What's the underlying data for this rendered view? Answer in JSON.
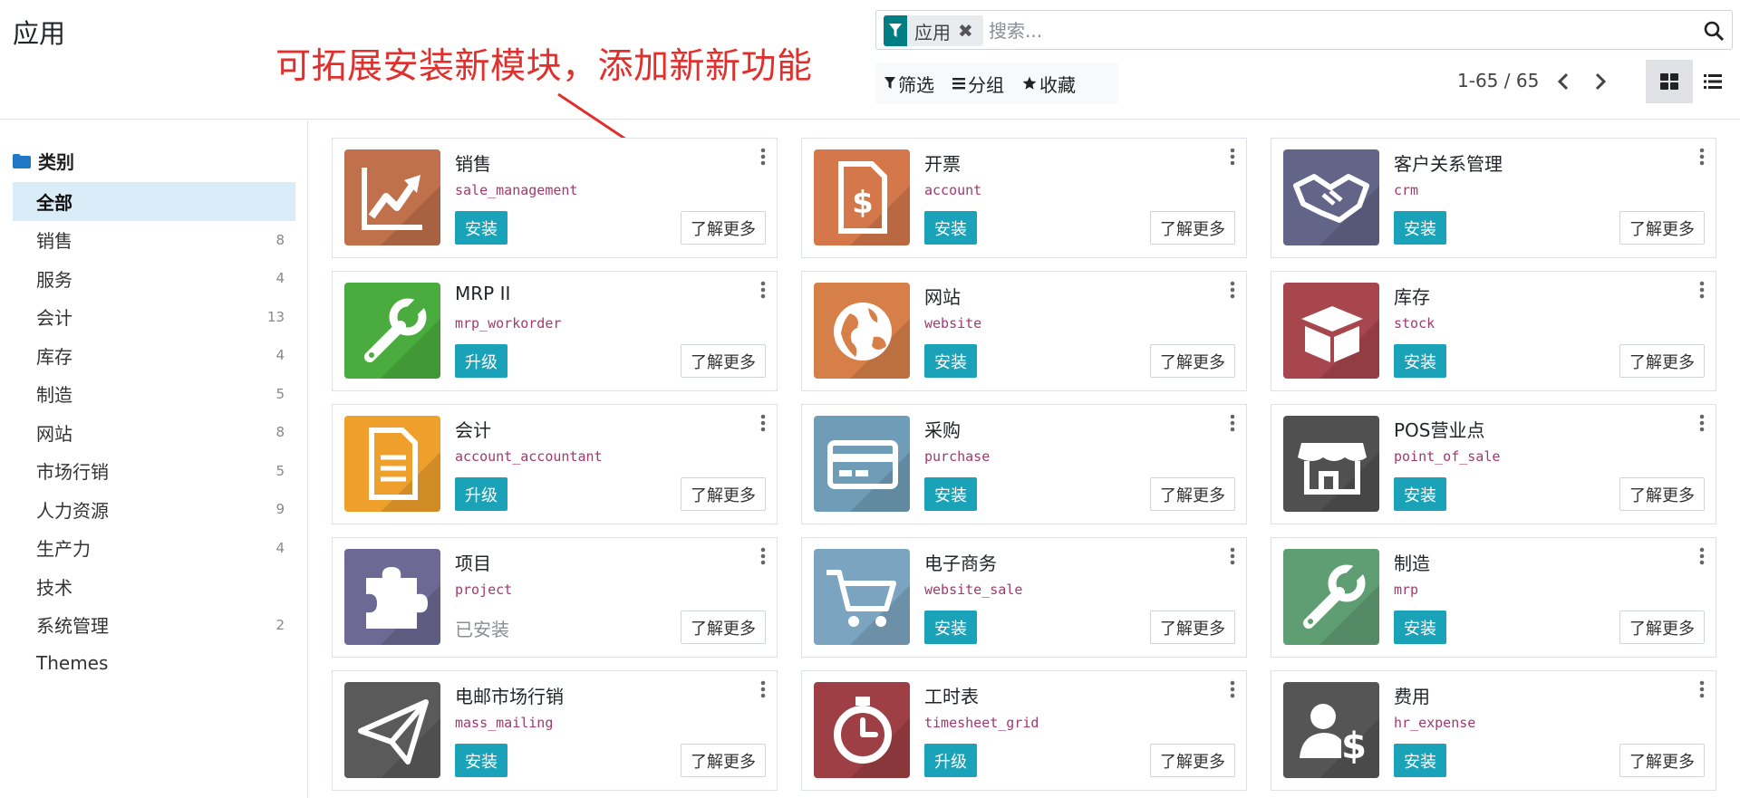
{
  "page": {
    "title": "应用",
    "annotation": "可拓展安装新模块，添加新新功能"
  },
  "search": {
    "facet_label": "应用",
    "facet_icon": "filter-icon",
    "placeholder": "搜索...",
    "search_icon": "magnifier-icon"
  },
  "filters": {
    "filter_label": "筛选",
    "group_label": "分组",
    "favorites_label": "收藏"
  },
  "pager": {
    "value": "1-65 / 65"
  },
  "views": {
    "active": "kanban",
    "kanban_icon": "grid-icon",
    "list_icon": "list-icon"
  },
  "sidebar": {
    "header": "类别",
    "header_icon": "folder-icon",
    "items": [
      {
        "label": "全部",
        "count": "",
        "active": true
      },
      {
        "label": "销售",
        "count": "8"
      },
      {
        "label": "服务",
        "count": "4"
      },
      {
        "label": "会计",
        "count": "13"
      },
      {
        "label": "库存",
        "count": "4"
      },
      {
        "label": "制造",
        "count": "5"
      },
      {
        "label": "网站",
        "count": "8"
      },
      {
        "label": "市场行销",
        "count": "5"
      },
      {
        "label": "人力资源",
        "count": "9"
      },
      {
        "label": "生产力",
        "count": "4"
      },
      {
        "label": "技术",
        "count": ""
      },
      {
        "label": "系统管理",
        "count": "2"
      },
      {
        "label": "Themes",
        "count": ""
      }
    ]
  },
  "learn_more_label": "了解更多",
  "apps": [
    {
      "name": "销售",
      "tech": "sale_management",
      "action": "安装",
      "state": "install",
      "icon": "chart-up-icon",
      "color": "#c0704a"
    },
    {
      "name": "开票",
      "tech": "account",
      "action": "安装",
      "state": "install",
      "icon": "invoice-dollar-icon",
      "color": "#d4774a"
    },
    {
      "name": "客户关系管理",
      "tech": "crm",
      "action": "安装",
      "state": "install",
      "icon": "handshake-icon",
      "color": "#636588"
    },
    {
      "name": "MRP II",
      "tech": "mrp_workorder",
      "action": "升级",
      "state": "upgrade",
      "icon": "wrench-icon",
      "color": "#4aab3e"
    },
    {
      "name": "网站",
      "tech": "website",
      "action": "安装",
      "state": "install",
      "icon": "globe-icon",
      "color": "#d77f48"
    },
    {
      "name": "库存",
      "tech": "stock",
      "action": "安装",
      "state": "install",
      "icon": "box-icon",
      "color": "#a8464d"
    },
    {
      "name": "会计",
      "tech": "account_accountant",
      "action": "升级",
      "state": "upgrade",
      "icon": "document-icon",
      "color": "#efa02c"
    },
    {
      "name": "采购",
      "tech": "purchase",
      "action": "安装",
      "state": "install",
      "icon": "credit-card-icon",
      "color": "#6f9cb6"
    },
    {
      "name": "POS营业点",
      "tech": "point_of_sale",
      "action": "安装",
      "state": "install",
      "icon": "store-icon",
      "color": "#505050"
    },
    {
      "name": "项目",
      "tech": "project",
      "action": "已安装",
      "state": "installed",
      "icon": "puzzle-icon",
      "color": "#6d6995"
    },
    {
      "name": "电子商务",
      "tech": "website_sale",
      "action": "安装",
      "state": "install",
      "icon": "cart-icon",
      "color": "#7aa4bf"
    },
    {
      "name": "制造",
      "tech": "mrp",
      "action": "安装",
      "state": "install",
      "icon": "wrench-icon",
      "color": "#5f9d73"
    },
    {
      "name": "电邮市场行销",
      "tech": "mass_mailing",
      "action": "安装",
      "state": "install",
      "icon": "paper-plane-icon",
      "color": "#5a5a5a"
    },
    {
      "name": "工时表",
      "tech": "timesheet_grid",
      "action": "升级",
      "state": "upgrade",
      "icon": "stopwatch-icon",
      "color": "#9e3f45"
    },
    {
      "name": "费用",
      "tech": "hr_expense",
      "action": "安装",
      "state": "install",
      "icon": "user-dollar-icon",
      "color": "#555555"
    }
  ]
}
